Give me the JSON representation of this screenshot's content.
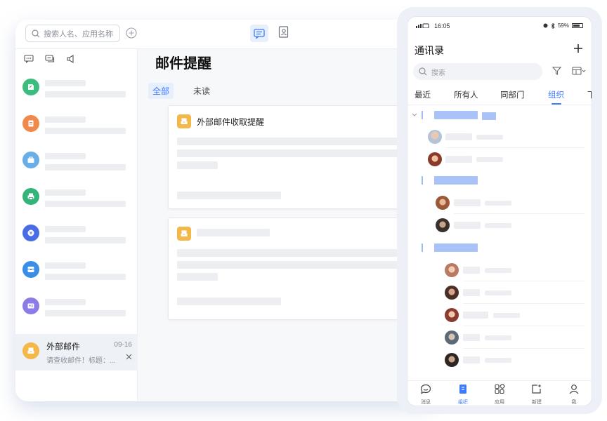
{
  "desktop": {
    "search_placeholder": "搜索人名、应用名称",
    "page_title": "邮件提醒",
    "tabs": {
      "all": "全部",
      "unread": "未读"
    },
    "conversations": [
      {
        "icon": "note-icon",
        "color": "#3dbd7d"
      },
      {
        "icon": "document-icon",
        "color": "#f08a4b"
      },
      {
        "icon": "briefcase-icon",
        "color": "#6aaee8"
      },
      {
        "icon": "printer-icon",
        "color": "#34b37a"
      },
      {
        "icon": "currency-icon",
        "color": "#4a6de5"
      },
      {
        "icon": "archive-icon",
        "color": "#3b8ee8"
      },
      {
        "icon": "contact-card-icon",
        "color": "#8a7be8"
      }
    ],
    "active_conversation": {
      "name": "外部邮件",
      "date": "09-16",
      "preview": "请查收邮件！标题：...",
      "color": "#f4b84a"
    },
    "cards": [
      {
        "title": "外部邮件收取提醒"
      },
      {
        "title": ""
      }
    ]
  },
  "phone": {
    "status": {
      "time": "16:05",
      "battery": "59%"
    },
    "title": "通讯录",
    "search_placeholder": "搜索",
    "tabs": [
      "最近",
      "所有人",
      "同部门",
      "组织",
      "下"
    ],
    "active_tab_index": 3,
    "nav": [
      {
        "label": "消息",
        "icon": "chat-bubble-icon"
      },
      {
        "label": "组织",
        "icon": "org-icon"
      },
      {
        "label": "应用",
        "icon": "apps-grid-icon"
      },
      {
        "label": "新建",
        "icon": "new-icon"
      },
      {
        "label": "我",
        "icon": "profile-icon"
      }
    ],
    "active_nav_index": 1
  },
  "colors": {
    "accent": "#3d7bff",
    "mail": "#f4b84a"
  }
}
